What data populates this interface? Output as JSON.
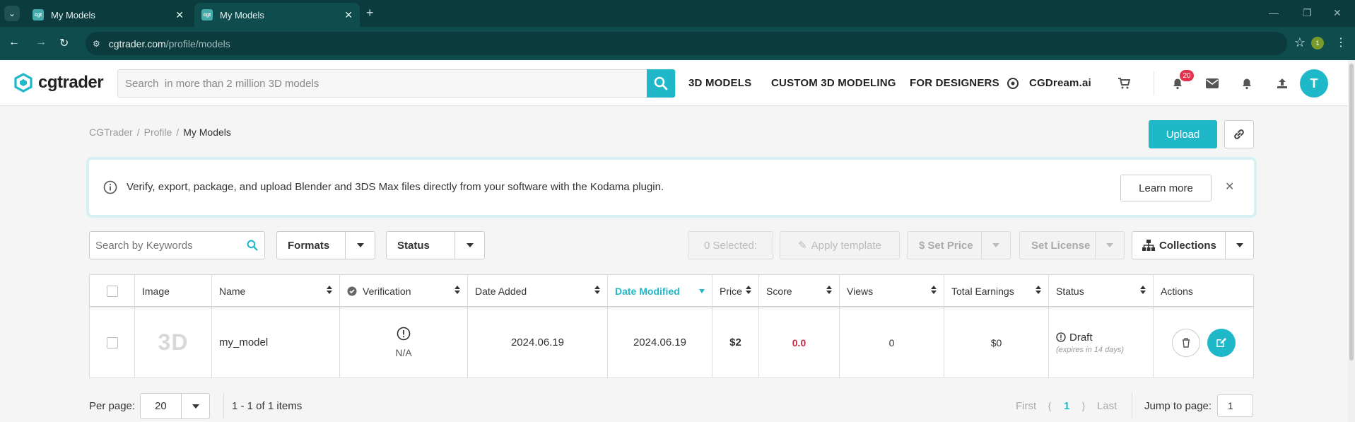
{
  "browser": {
    "tabs": [
      {
        "title": "My Models",
        "favicon": "cgt"
      },
      {
        "title": "My Models",
        "favicon": "cgt"
      }
    ],
    "url_domain": "cgtrader.com",
    "url_path": "/profile/models",
    "extension_badge": "1"
  },
  "header": {
    "logo_text": "cgtrader",
    "search_placeholder": "Search  in more than 2 million 3D models",
    "nav": [
      "3D MODELS",
      "CUSTOM 3D MODELING",
      "FOR DESIGNERS",
      "CGDream.ai"
    ],
    "notifications_count": "20",
    "avatar_initial": "T",
    "accent_color": "#1fb8c8"
  },
  "breadcrumb": [
    "CGTrader",
    "Profile",
    "My Models"
  ],
  "actions": {
    "upload_label": "Upload"
  },
  "banner": {
    "message": "Verify, export, package, and upload Blender and 3DS Max files directly from your software with the Kodama plugin.",
    "learn_more": "Learn more"
  },
  "toolbar": {
    "search_placeholder": "Search by Keywords",
    "formats_label": "Formats",
    "status_label": "Status",
    "selected_label": "0 Selected:",
    "apply_template": "Apply template",
    "set_price": "Set Price",
    "set_license": "Set License",
    "collections": "Collections"
  },
  "table": {
    "columns": [
      "Image",
      "Name",
      "Verification",
      "Date Added",
      "Date Modified",
      "Price",
      "Score",
      "Views",
      "Total Earnings",
      "Status",
      "Actions"
    ],
    "sorted_column": "Date Modified",
    "rows": [
      {
        "image_placeholder": "3D",
        "name": "my_model",
        "verification": "N/A",
        "date_added": "2024.06.19",
        "date_modified": "2024.06.19",
        "price": "$2",
        "score": "0.0",
        "views": "0",
        "total_earnings": "$0",
        "status": "Draft",
        "status_note": "(expires in 14 days)"
      }
    ]
  },
  "footer": {
    "per_page_label": "Per page:",
    "per_page_value": "20",
    "items_summary": "1 - 1 of 1 items",
    "first": "First",
    "prev": "⟨",
    "current_page": "1",
    "next": "⟩",
    "last": "Last",
    "jump_label": "Jump to page:",
    "jump_value": "1"
  }
}
